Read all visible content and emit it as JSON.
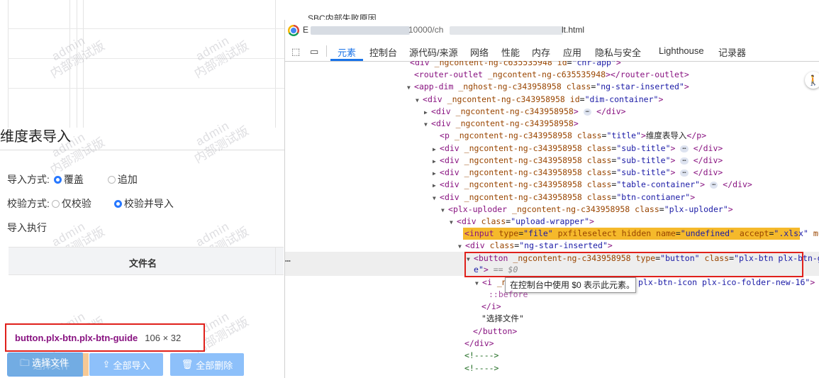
{
  "app": {
    "top_text": "SBC内部失败原因",
    "title": "维度表导入",
    "import_mode_label": "导入方式:",
    "import_options": [
      "覆盖",
      "追加"
    ],
    "import_selected": "覆盖",
    "verify_mode_label": "校验方式:",
    "verify_options": [
      "仅校验",
      "校验并导入"
    ],
    "verify_selected": "校验并导入",
    "exec_label": "导入执行",
    "table_header": "文件名",
    "buttons": {
      "select_file": "选择文件",
      "import_all": "全部导入",
      "delete_all": "全部删除"
    },
    "watermark": {
      "line1": "admin",
      "line2": "内部测试版"
    }
  },
  "inspect_tooltip": {
    "selector_tag": "button",
    "selector_classes": ".plx-btn.plx-btn-guide",
    "size": "106 × 32"
  },
  "devtools": {
    "title_suffix": "lt.html",
    "title_prefix": "E",
    "title_mid": "10000/ch",
    "tabs": [
      "元素",
      "控制台",
      "源代码/来源",
      "网络",
      "性能",
      "内存",
      "应用",
      "隐私与安全",
      "Lighthouse",
      "记录器"
    ],
    "active_tab": "元素",
    "dollar_zero_tooltip": "在控制台中使用 $0 表示此元素。",
    "dollar_zero": "== $0",
    "dots": "…",
    "ellipsis": "⋯",
    "lines": {
      "l0": {
        "tag": "div",
        "attr": "_ngcontent-ng-c635535948",
        "id_name": "id",
        "id_val": "chr-app"
      },
      "l1": {
        "open": "<router-outlet",
        "attr": "_ngcontent-ng-c635535948",
        "close": "</router-outlet>"
      },
      "l2": {
        "tag": "app-dim",
        "attr": "_nghost-ng-c343958958",
        "an": "class",
        "av": "ng-star-inserted"
      },
      "l3": {
        "tag": "div",
        "attr": "_ngcontent-ng-c343958958",
        "an": "id",
        "av": "dim-container"
      },
      "l4": {
        "tag": "div",
        "attr": "_ngcontent-ng-c343958958",
        "close": "</div>"
      },
      "l5": {
        "tag": "div",
        "attr": "_ngcontent-ng-c343958958"
      },
      "l6": {
        "tag": "p",
        "attr": "_ngcontent-ng-c343958958",
        "an": "class",
        "av": "title",
        "text": "维度表导入",
        "close": "</p>"
      },
      "l7": {
        "tag": "div",
        "attr": "_ngcontent-ng-c343958958",
        "an": "class",
        "av": "sub-title",
        "close": "</div>"
      },
      "l8": {
        "tag": "div",
        "attr": "_ngcontent-ng-c343958958",
        "an": "class",
        "av": "sub-title",
        "close": "</div>"
      },
      "l9": {
        "tag": "div",
        "attr": "_ngcontent-ng-c343958958",
        "an": "class",
        "av": "sub-title",
        "close": "</div>"
      },
      "l10": {
        "tag": "div",
        "attr": "_ngcontent-ng-c343958958",
        "an": "class",
        "av": "table-container",
        "close": "</div>"
      },
      "l11": {
        "tag": "div",
        "attr": "_ngcontent-ng-c343958958",
        "an": "class",
        "av": "btn-contianer"
      },
      "l12": {
        "tag": "plx-uploder",
        "attr": "_ngcontent-ng-c343958958",
        "an": "class",
        "av": "plx-uploder"
      },
      "l13": {
        "tag": "div",
        "an": "class",
        "av": "upload-wrapper"
      },
      "l14": {
        "tag": "input",
        "a1n": "type",
        "a1v": "file",
        "a2": "pxfileselect hidden",
        "a3n": "name",
        "a3v": "undefined",
        "a4n": "accept",
        "a4v": ".xlsx",
        "a5": "multiple"
      },
      "l15": {
        "tag": "div",
        "an": "class",
        "av": "ng-star-inserted"
      },
      "l16": {
        "tag": "button",
        "attr": "_ngcontent-ng-c343958958",
        "a1n": "type",
        "a1v": "button",
        "a2n": "class",
        "a2v_1": "plx-btn plx-btn-guid",
        "a2v_2": "e"
      },
      "l17": {
        "tag": "i",
        "frag_start": "_n",
        "frag_end": "plx-btn-icon plx-ico-folder-new-16"
      },
      "l18": {
        "text": "::before"
      },
      "l19": {
        "text": "</i>"
      },
      "l20": {
        "text": "\"选择文件\""
      },
      "l21": {
        "text": "</button>"
      },
      "l22": {
        "text": "</div>"
      },
      "l23": {
        "text": "<!---->"
      },
      "l24": {
        "text": "<!---->"
      }
    }
  }
}
